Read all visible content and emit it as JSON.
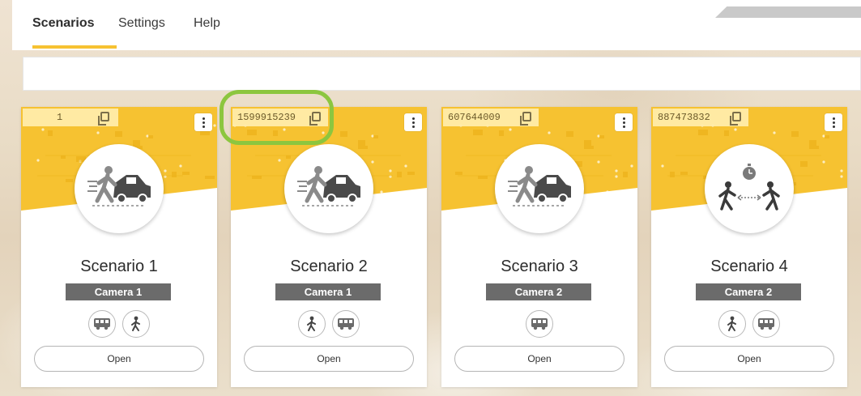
{
  "nav": {
    "tabs": [
      {
        "label": "Scenarios",
        "active": true
      },
      {
        "label": "Settings",
        "active": false
      },
      {
        "label": "Help",
        "active": false
      }
    ]
  },
  "colors": {
    "accent_yellow": "#f6c231",
    "highlight_green": "#8cc63f",
    "badge_gray": "#6b6b6b"
  },
  "cards": [
    {
      "id": "1",
      "title": "Scenario 1",
      "camera": "Camera 1",
      "icon": "intrusion-vehicle-icon",
      "chips": [
        "bus-icon",
        "person-walking-icon"
      ],
      "open_label": "Open"
    },
    {
      "id": "1599915239",
      "title": "Scenario 2",
      "camera": "Camera 1",
      "icon": "intrusion-vehicle-icon",
      "chips": [
        "person-walking-icon",
        "bus-icon"
      ],
      "open_label": "Open"
    },
    {
      "id": "607644009",
      "title": "Scenario 3",
      "camera": "Camera 2",
      "icon": "intrusion-vehicle-icon",
      "chips": [
        "bus-icon"
      ],
      "open_label": "Open"
    },
    {
      "id": "887473832",
      "title": "Scenario 4",
      "camera": "Camera 2",
      "icon": "social-distance-timer-icon",
      "chips": [
        "person-walking-icon",
        "bus-icon"
      ],
      "open_label": "Open"
    }
  ]
}
